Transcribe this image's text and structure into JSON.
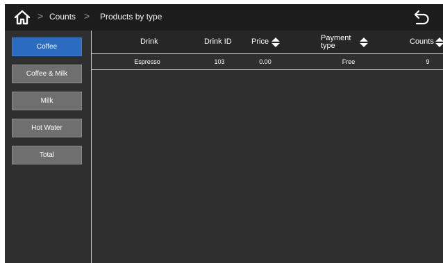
{
  "header": {
    "home_icon": "home-icon",
    "breadcrumb": [
      "Counts",
      "Products by type"
    ],
    "separator": ">",
    "back_icon": "back-arrow-icon"
  },
  "sidebar": {
    "items": [
      {
        "label": "Coffee",
        "active": true
      },
      {
        "label": "Coffee & Milk",
        "active": false
      },
      {
        "label": "Milk",
        "active": false
      },
      {
        "label": "Hot Water",
        "active": false
      },
      {
        "label": "Total",
        "active": false
      }
    ]
  },
  "table": {
    "columns": [
      {
        "label": "Drink",
        "sortable": false
      },
      {
        "label": "Drink ID",
        "sortable": false
      },
      {
        "label": "Price",
        "sortable": true
      },
      {
        "label": "Payment type",
        "sortable": true
      },
      {
        "label": "Counts",
        "sortable": true
      }
    ],
    "rows": [
      {
        "drink": "Espresso",
        "drink_id": "103",
        "price": "0.00",
        "payment_type": "Free",
        "counts": "9"
      }
    ]
  },
  "colors": {
    "active_tab": "#2b6bc0",
    "inactive_tab": "#6f6f6f",
    "background": "#2f2f2f",
    "header_bar": "#1c1c1c"
  }
}
